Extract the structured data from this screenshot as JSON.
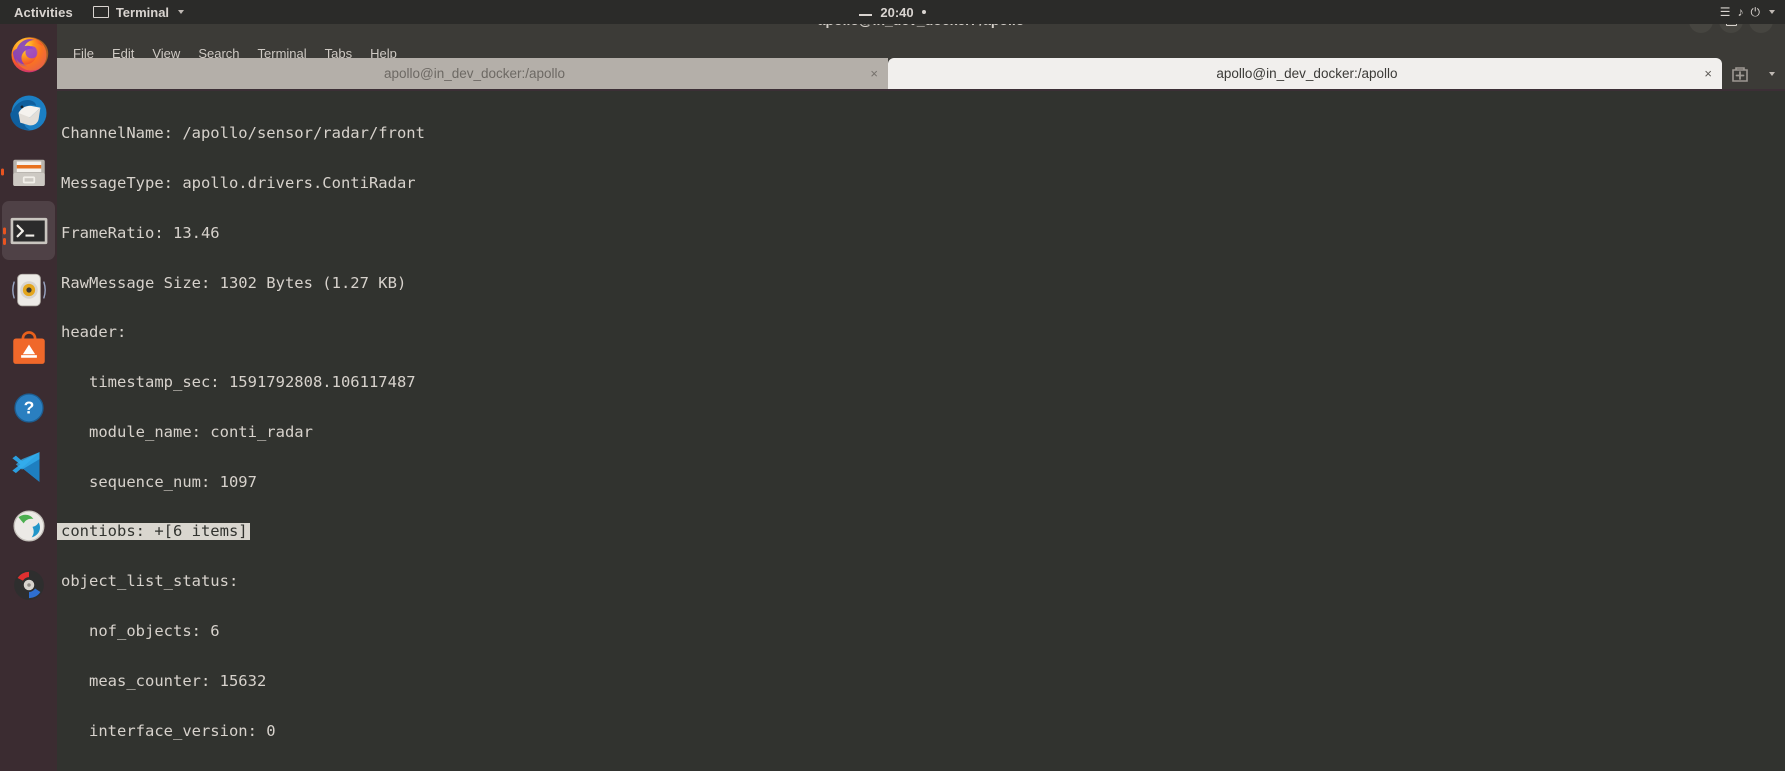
{
  "top_bar": {
    "activities_label": "Activities",
    "app_name": "Terminal",
    "app_icon": "terminal-window-icon",
    "clock": "20:40",
    "status_icons": [
      "network-icon",
      "volume-icon",
      "power-icon",
      "chevron-down-icon"
    ]
  },
  "dock": {
    "items": [
      {
        "name": "firefox",
        "label": "Firefox",
        "running": false,
        "active": false
      },
      {
        "name": "thunderbird",
        "label": "Thunderbird Mail",
        "running": false,
        "active": false
      },
      {
        "name": "files",
        "label": "Files",
        "running": true,
        "active": false
      },
      {
        "name": "terminal",
        "label": "Terminal",
        "running": true,
        "active": true
      },
      {
        "name": "rhythmbox",
        "label": "Rhythmbox",
        "running": false,
        "active": false
      },
      {
        "name": "ubuntu-software",
        "label": "Ubuntu Software",
        "running": false,
        "active": false
      },
      {
        "name": "help",
        "label": "Help",
        "running": false,
        "active": false
      },
      {
        "name": "vscode",
        "label": "Visual Studio Code",
        "running": false,
        "active": false
      },
      {
        "name": "webapp",
        "label": "Web Browser",
        "running": false,
        "active": false
      },
      {
        "name": "backups",
        "label": "Backups",
        "running": false,
        "active": false
      }
    ]
  },
  "window": {
    "title": "apollo@in_dev_docker: /apollo",
    "controls": {
      "minimize": "minimize-button",
      "maximize": "maximize-button",
      "close": "close-button"
    }
  },
  "menubar": {
    "items": [
      "File",
      "Edit",
      "View",
      "Search",
      "Terminal",
      "Tabs",
      "Help"
    ]
  },
  "tabbar": {
    "tabs": [
      {
        "label": "apollo@in_dev_docker:/apollo",
        "active": false,
        "close": "×"
      },
      {
        "label": "apollo@in_dev_docker:/apollo",
        "active": true,
        "close": "×"
      }
    ],
    "new_tab_icon": "new-tab-icon",
    "menu_icon": "hamburger-menu-icon"
  },
  "terminal": {
    "lines": [
      {
        "text": "ChannelName: /apollo/sensor/radar/front",
        "selected": false
      },
      {
        "text": "MessageType: apollo.drivers.ContiRadar",
        "selected": false
      },
      {
        "text": "FrameRatio: 13.46",
        "selected": false
      },
      {
        "text": "RawMessage Size: 1302 Bytes (1.27 KB)",
        "selected": false
      },
      {
        "text": "header:",
        "selected": false
      },
      {
        "text": "   timestamp_sec: 1591792808.106117487",
        "selected": false
      },
      {
        "text": "   module_name: conti_radar",
        "selected": false
      },
      {
        "text": "   sequence_num: 1097",
        "selected": false
      },
      {
        "text": "contiobs: +[6 items]",
        "selected": true
      },
      {
        "text": "object_list_status:",
        "selected": false
      },
      {
        "text": "   nof_objects: 6",
        "selected": false
      },
      {
        "text": "   meas_counter: 15632",
        "selected": false
      },
      {
        "text": "   interface_version: 0",
        "selected": false
      }
    ]
  },
  "colors": {
    "terminal_bg": "#31332f",
    "terminal_fg": "#d7d2cc",
    "selection_bg": "#d9d6cf",
    "titlebar_bg": "#3c3b37",
    "dock_bg": "#3b2c31",
    "accent": "#e95420"
  }
}
